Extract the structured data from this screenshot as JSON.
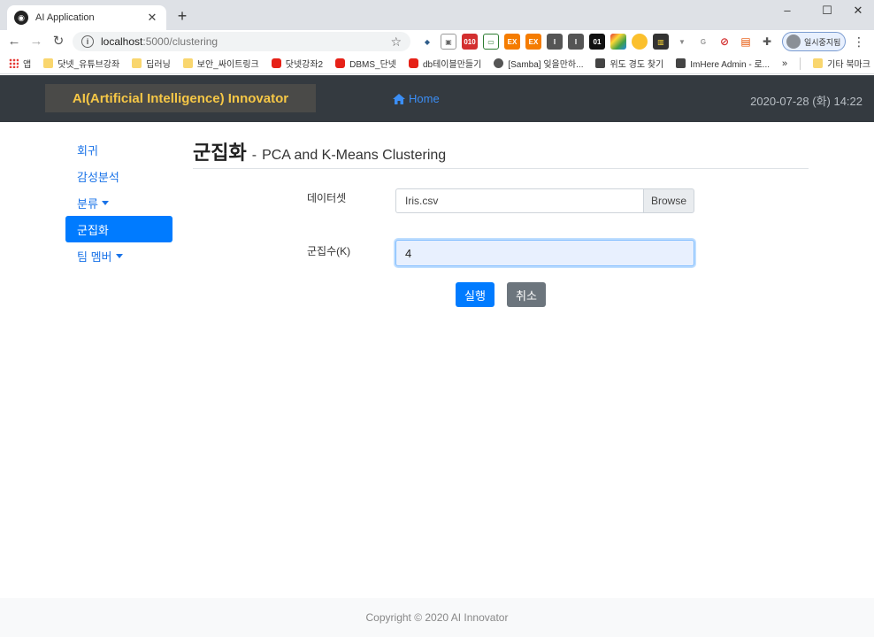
{
  "browser": {
    "tab_title": "AI Application",
    "tab_close": "✕",
    "new_tab": "+",
    "url_host": "localhost",
    "url_path": ":5000/clustering",
    "profile_label": "일시중지됨",
    "window_controls": {
      "minimize": "–",
      "maximize": "☐",
      "close": "✕"
    },
    "bookmarks": [
      {
        "label": "앱",
        "icon": "apps-icon"
      },
      {
        "label": "닷넷_유튜브강좌",
        "icon": "folder-icon"
      },
      {
        "label": "딥러닝",
        "icon": "folder-icon"
      },
      {
        "label": "보안_싸이트링크",
        "icon": "folder-icon"
      },
      {
        "label": "닷넷강좌2",
        "icon": "youtube-icon"
      },
      {
        "label": "DBMS_단넷",
        "icon": "youtube-icon"
      },
      {
        "label": "db테이블만들기",
        "icon": "youtube-icon"
      },
      {
        "label": "[Samba] 잊을만하...",
        "icon": "globe-icon"
      },
      {
        "label": "위도 경도 찾기",
        "icon": "page-icon"
      },
      {
        "label": "ImHere Admin - 로...",
        "icon": "page-icon"
      }
    ],
    "bookmarks_more": "»",
    "other_bookmarks": "기타 북마크"
  },
  "app": {
    "brand": "AI(Artificial Intelligence) Innovator",
    "home_label": "Home",
    "datetime": "2020-07-28 (화) 14:22",
    "sidebar": [
      {
        "label": "회귀",
        "active": false,
        "dropdown": false
      },
      {
        "label": "감성분석",
        "active": false,
        "dropdown": false
      },
      {
        "label": "분류",
        "active": false,
        "dropdown": true
      },
      {
        "label": "군집화",
        "active": true,
        "dropdown": false
      },
      {
        "label": "팀 멤버",
        "active": false,
        "dropdown": true
      }
    ],
    "page_title": "군집화",
    "page_title_sep": "-",
    "page_subtitle": "PCA and K-Means Clustering",
    "dataset_label": "데이터셋",
    "dataset_file": "Iris.csv",
    "browse_label": "Browse",
    "k_label": "군집수(K)",
    "k_value": "4",
    "run_label": "실행",
    "cancel_label": "취소",
    "footer": "Copyright © 2020 AI Innovator",
    "colors": {
      "navbar": "#343a40",
      "brand_text": "#f6c746",
      "primary": "#007bff",
      "secondary": "#6c757d"
    }
  }
}
